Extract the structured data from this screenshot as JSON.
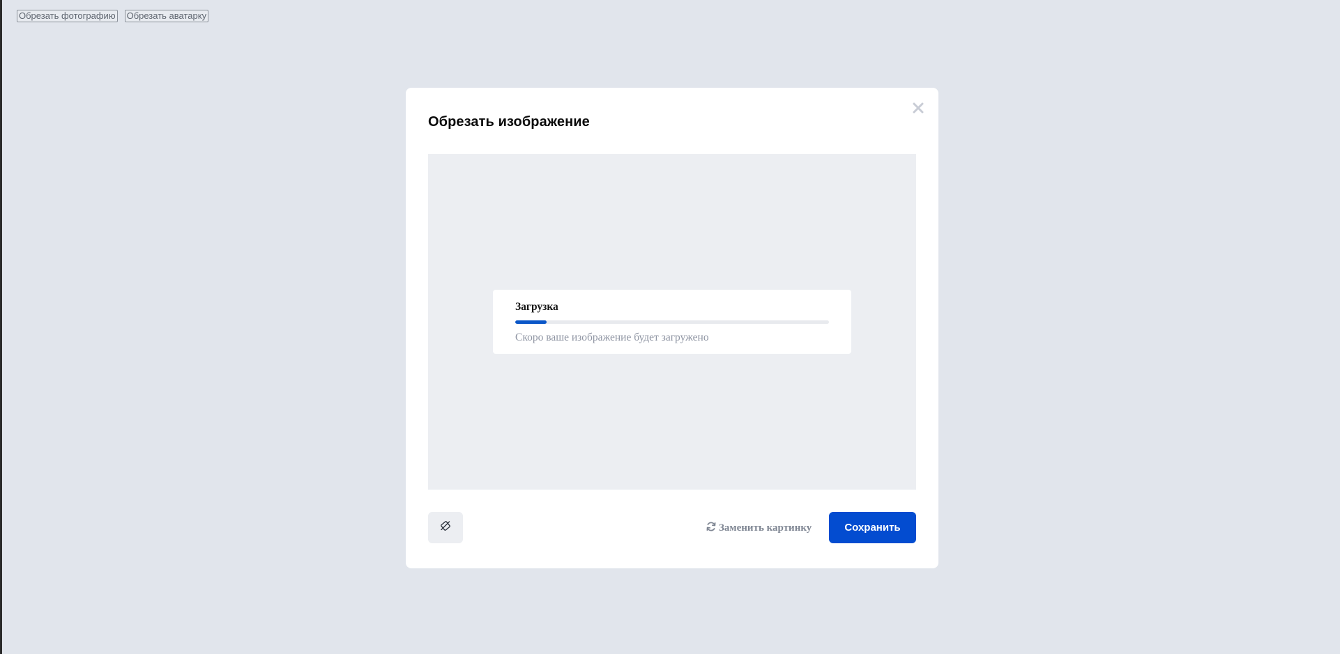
{
  "top_bar": {
    "crop_photo_label": "Обрезать фотографию",
    "crop_avatar_label": "Обрезать аватарку"
  },
  "modal": {
    "title": "Обрезать изображение",
    "close_icon": "close-icon",
    "loading": {
      "title": "Загрузка",
      "progress": 0.1,
      "subtitle": "Скоро ваше изображение будет загружено"
    },
    "rotate_icon": "rotate-icon",
    "replace_icon": "refresh-icon",
    "replace_label": "Заменить картинку",
    "save_label": "Сохранить"
  },
  "colors": {
    "page_background": "#e1e5ec",
    "crop_area_background": "#eceef2",
    "accent": "#034cd0",
    "progress_fill": "#0a56c8",
    "muted_text": "#8f95a3"
  }
}
